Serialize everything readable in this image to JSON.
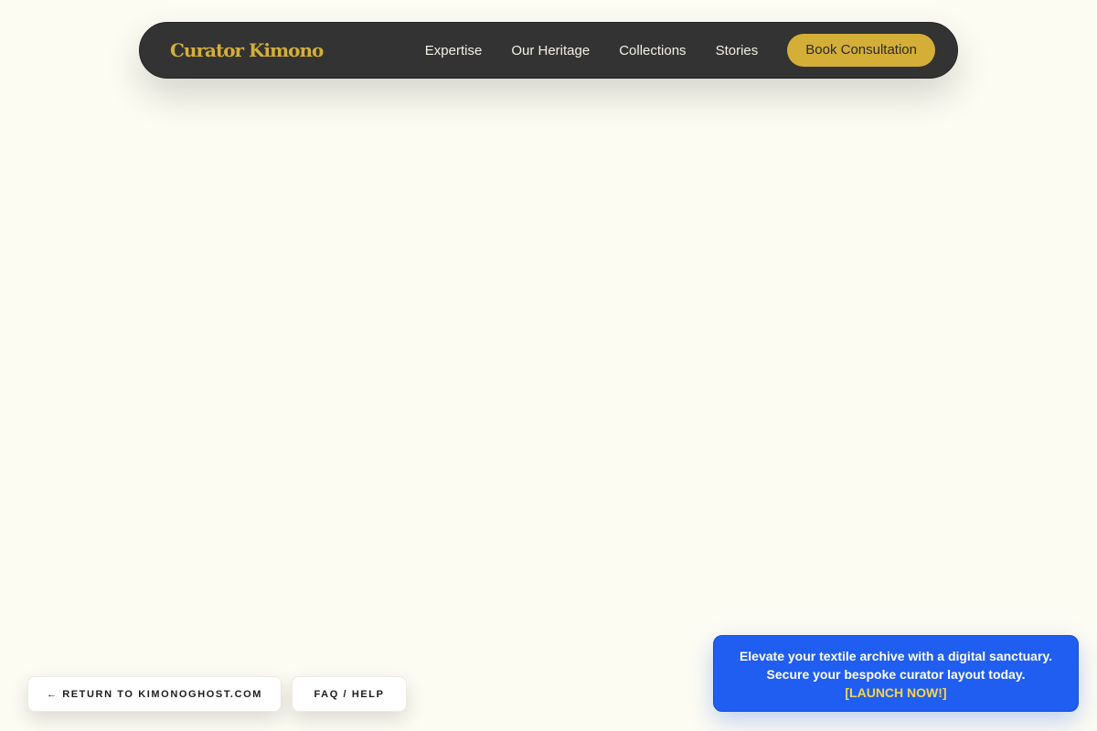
{
  "navbar": {
    "brand": "Curator Kimono",
    "links": [
      "Expertise",
      "Our Heritage",
      "Collections",
      "Stories"
    ],
    "cta_label": "Book Consultation"
  },
  "footer_buttons": {
    "return_label": "← RETURN TO KIMONOGHOST.COM",
    "faq_label": "FAQ / HELP"
  },
  "promo": {
    "line1": "Elevate your textile archive with a digital sanctuary.",
    "line2": "Secure your bespoke curator layout today.",
    "link_label": "[LAUNCH NOW!]"
  },
  "colors": {
    "background": "#fdfcf3",
    "navbar": "#333333",
    "accent_gold": "#d4af37",
    "promo_blue": "#1f5ef0",
    "promo_link": "#f7d54a"
  }
}
